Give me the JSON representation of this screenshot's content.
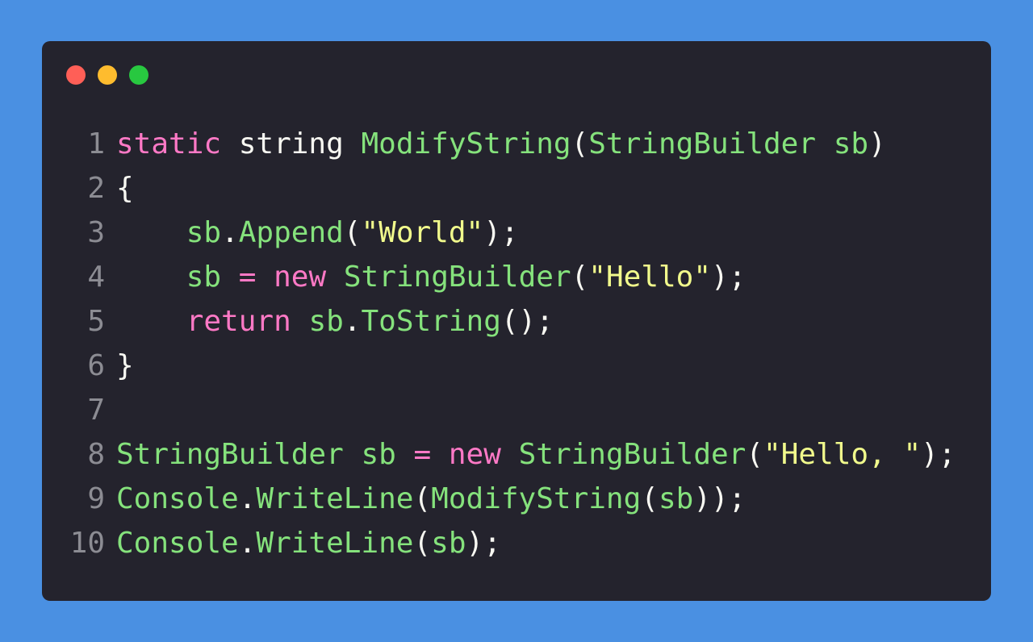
{
  "colors": {
    "background": "#4a90e2",
    "window": "#24232d",
    "light_red": "#ff5f57",
    "light_yellow": "#febc2e",
    "light_green": "#28c840",
    "keyword": "#ff79c6",
    "identifier": "#85e27c",
    "string": "#f1fa8c",
    "plain": "#f8f8f2",
    "line_number": "#8c8c93"
  },
  "lines": [
    {
      "number": "1",
      "tokens": [
        {
          "text": "static",
          "type": "kw"
        },
        {
          "text": " ",
          "type": "plain"
        },
        {
          "text": "string",
          "type": "def"
        },
        {
          "text": " ",
          "type": "plain"
        },
        {
          "text": "ModifyString",
          "type": "fn"
        },
        {
          "text": "(",
          "type": "plain"
        },
        {
          "text": "StringBuilder",
          "type": "fn"
        },
        {
          "text": " ",
          "type": "plain"
        },
        {
          "text": "sb",
          "type": "fn"
        },
        {
          "text": ")",
          "type": "plain"
        }
      ]
    },
    {
      "number": "2",
      "tokens": [
        {
          "text": "{",
          "type": "plain"
        }
      ]
    },
    {
      "number": "3",
      "tokens": [
        {
          "text": "    ",
          "type": "plain"
        },
        {
          "text": "sb",
          "type": "fn"
        },
        {
          "text": ".",
          "type": "plain"
        },
        {
          "text": "Append",
          "type": "fn"
        },
        {
          "text": "(",
          "type": "plain"
        },
        {
          "text": "\"World\"",
          "type": "str"
        },
        {
          "text": ");",
          "type": "plain"
        }
      ]
    },
    {
      "number": "4",
      "tokens": [
        {
          "text": "    ",
          "type": "plain"
        },
        {
          "text": "sb",
          "type": "fn"
        },
        {
          "text": " ",
          "type": "plain"
        },
        {
          "text": "=",
          "type": "kw"
        },
        {
          "text": " ",
          "type": "plain"
        },
        {
          "text": "new",
          "type": "kw"
        },
        {
          "text": " ",
          "type": "plain"
        },
        {
          "text": "StringBuilder",
          "type": "fn"
        },
        {
          "text": "(",
          "type": "plain"
        },
        {
          "text": "\"Hello\"",
          "type": "str"
        },
        {
          "text": ");",
          "type": "plain"
        }
      ]
    },
    {
      "number": "5",
      "tokens": [
        {
          "text": "    ",
          "type": "plain"
        },
        {
          "text": "return",
          "type": "kw"
        },
        {
          "text": " ",
          "type": "plain"
        },
        {
          "text": "sb",
          "type": "fn"
        },
        {
          "text": ".",
          "type": "plain"
        },
        {
          "text": "ToString",
          "type": "fn"
        },
        {
          "text": "();",
          "type": "plain"
        }
      ]
    },
    {
      "number": "6",
      "tokens": [
        {
          "text": "}",
          "type": "plain"
        }
      ]
    },
    {
      "number": "7",
      "tokens": []
    },
    {
      "number": "8",
      "tokens": [
        {
          "text": "StringBuilder",
          "type": "fn"
        },
        {
          "text": " ",
          "type": "plain"
        },
        {
          "text": "sb",
          "type": "fn"
        },
        {
          "text": " ",
          "type": "plain"
        },
        {
          "text": "=",
          "type": "kw"
        },
        {
          "text": " ",
          "type": "plain"
        },
        {
          "text": "new",
          "type": "kw"
        },
        {
          "text": " ",
          "type": "plain"
        },
        {
          "text": "StringBuilder",
          "type": "fn"
        },
        {
          "text": "(",
          "type": "plain"
        },
        {
          "text": "\"Hello, \"",
          "type": "str"
        },
        {
          "text": ");",
          "type": "plain"
        }
      ]
    },
    {
      "number": "9",
      "tokens": [
        {
          "text": "Console",
          "type": "fn"
        },
        {
          "text": ".",
          "type": "plain"
        },
        {
          "text": "WriteLine",
          "type": "fn"
        },
        {
          "text": "(",
          "type": "plain"
        },
        {
          "text": "ModifyString",
          "type": "fn"
        },
        {
          "text": "(",
          "type": "plain"
        },
        {
          "text": "sb",
          "type": "fn"
        },
        {
          "text": "));",
          "type": "plain"
        }
      ]
    },
    {
      "number": "10",
      "tokens": [
        {
          "text": "Console",
          "type": "fn"
        },
        {
          "text": ".",
          "type": "plain"
        },
        {
          "text": "WriteLine",
          "type": "fn"
        },
        {
          "text": "(",
          "type": "plain"
        },
        {
          "text": "sb",
          "type": "fn"
        },
        {
          "text": ");",
          "type": "plain"
        }
      ]
    }
  ]
}
